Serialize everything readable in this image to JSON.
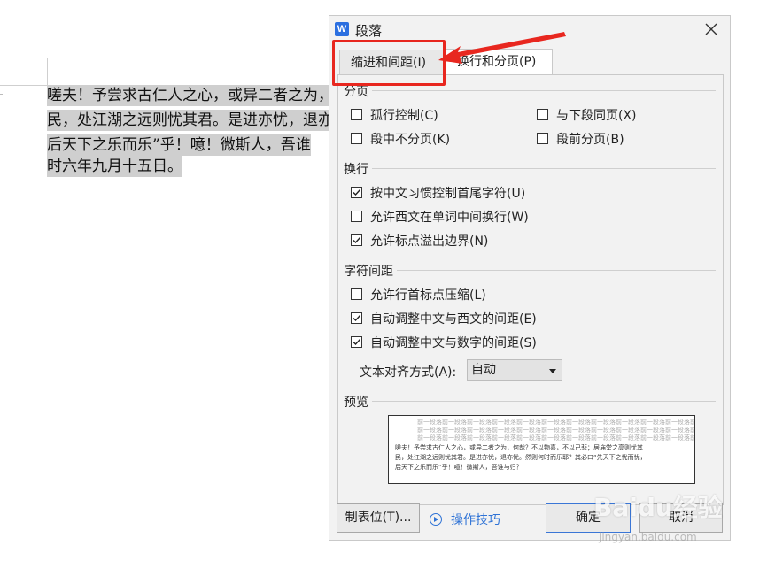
{
  "document": {
    "lines": [
      "嗟夫！予尝求古仁人之心，或异二者之为，",
      "民，处江湖之远则忧其君。是进亦忧，退亦",
      "后天下之乐而乐”乎！噫！微斯人，吾谁",
      "时六年九月十五日。"
    ]
  },
  "dialog": {
    "title": "段落",
    "app_icon": "W",
    "close_icon": "close-icon",
    "tabs": [
      {
        "label": "缩进和间距(I)",
        "active": false
      },
      {
        "label": "换行和分页(P)",
        "active": true
      }
    ],
    "sections": {
      "pagination": {
        "label": "分页",
        "options": [
          {
            "label": "孤行控制(C)",
            "checked": false
          },
          {
            "label": "与下段同页(X)",
            "checked": false
          },
          {
            "label": "段中不分页(K)",
            "checked": false
          },
          {
            "label": "段前分页(B)",
            "checked": false
          }
        ]
      },
      "line_break": {
        "label": "换行",
        "options": [
          {
            "label": "按中文习惯控制首尾字符(U)",
            "checked": true
          },
          {
            "label": "允许西文在单词中间换行(W)",
            "checked": false
          },
          {
            "label": "允许标点溢出边界(N)",
            "checked": true
          }
        ]
      },
      "char_spacing": {
        "label": "字符间距",
        "options": [
          {
            "label": "允许行首标点压缩(L)",
            "checked": false
          },
          {
            "label": "自动调整中文与西文的间距(E)",
            "checked": true
          },
          {
            "label": "自动调整中文与数字的间距(S)",
            "checked": true
          }
        ]
      }
    },
    "text_align": {
      "label": "文本对齐方式(A):",
      "value": "自动"
    },
    "preview": {
      "label": "预览",
      "gray_text": "前一段落前一段落前一段落前一段落前一段落前一段落前一段落前一段落前一段落前一段落前一段落前一段落",
      "sample_lines": [
        "嗟夫！予尝求古仁人之心，或异二者之为，何哉？不以物喜，不以己悲；居庙堂之高则忧其",
        "民，处江湖之远则忧其君。是进亦忧，退亦忧。然则何时而乐耶？其必曰“先天下之忧而忧，",
        "后天下之乐而乐”乎！噫！微斯人，吾谁与归？"
      ]
    },
    "buttons": {
      "tabs": "制表位(T)...",
      "tips": "操作技巧",
      "ok": "确定",
      "cancel": "取消"
    }
  },
  "annotation": {
    "color": "#e8271f"
  },
  "watermark": {
    "main": "Baidu经验",
    "sub": "jingyan.baidu.com"
  }
}
